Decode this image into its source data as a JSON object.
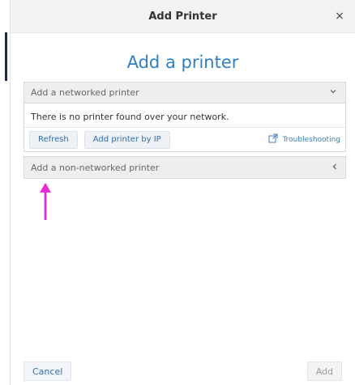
{
  "window": {
    "title": "Add Printer",
    "close_symbol": "×"
  },
  "main": {
    "heading": "Add a printer",
    "networked": {
      "header_label": "Add a networked printer",
      "message": "There is no printer found over your network.",
      "buttons": [
        "Refresh",
        "Add printer by IP"
      ],
      "troubleshooting_label": "Troubleshooting"
    },
    "non_networked": {
      "header_label": "Add a non-networked printer"
    }
  },
  "footer": {
    "cancel_label": "Cancel",
    "add_label": "Add"
  },
  "colors": {
    "accent": "#2f7fc6",
    "arrow": "#e62bd6"
  },
  "icons": {
    "networked_chevron": "chevron-down-icon",
    "non_networked_chevron": "chevron-left-icon",
    "troubleshooting": "external-link-icon",
    "close": "close-icon"
  }
}
